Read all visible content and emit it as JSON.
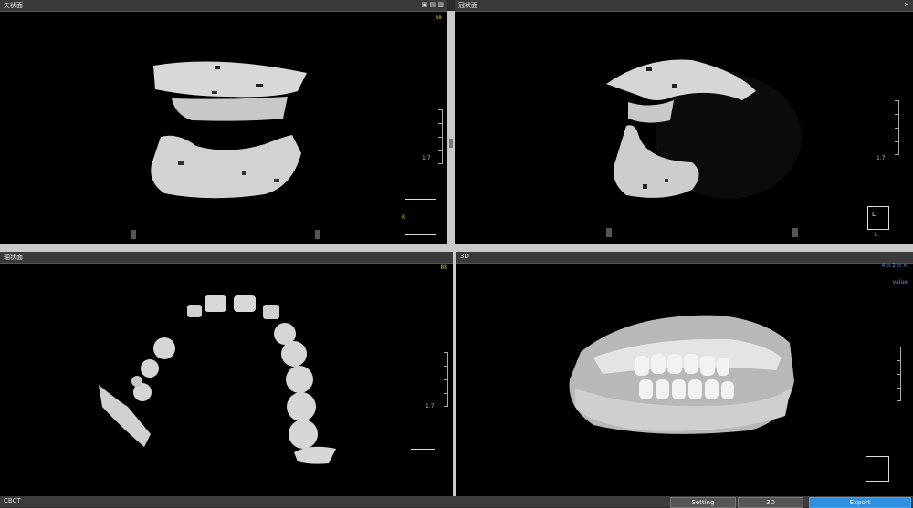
{
  "viewports": {
    "top_left": {
      "title": "矢状面",
      "controls": "▣ ▤ ▥",
      "corner_label": "88",
      "scale_value": "1.7",
      "orient_label": "R"
    },
    "top_right": {
      "title": "冠状面",
      "controls": "×",
      "scale_value": "1.7",
      "orient_label": "L",
      "corner_label": "L"
    },
    "bottom_left": {
      "title": "轴状面",
      "corner_label": "88",
      "scale_value": "1.7"
    },
    "bottom_right": {
      "title": "3D",
      "top_right_label": "4 ▫ 2 ▫ <",
      "top_right_value": "value"
    }
  },
  "bottom_bar": {
    "left_text": "CBCT",
    "btn1": "Setting",
    "btn2": "3D",
    "btn3": "Export"
  }
}
